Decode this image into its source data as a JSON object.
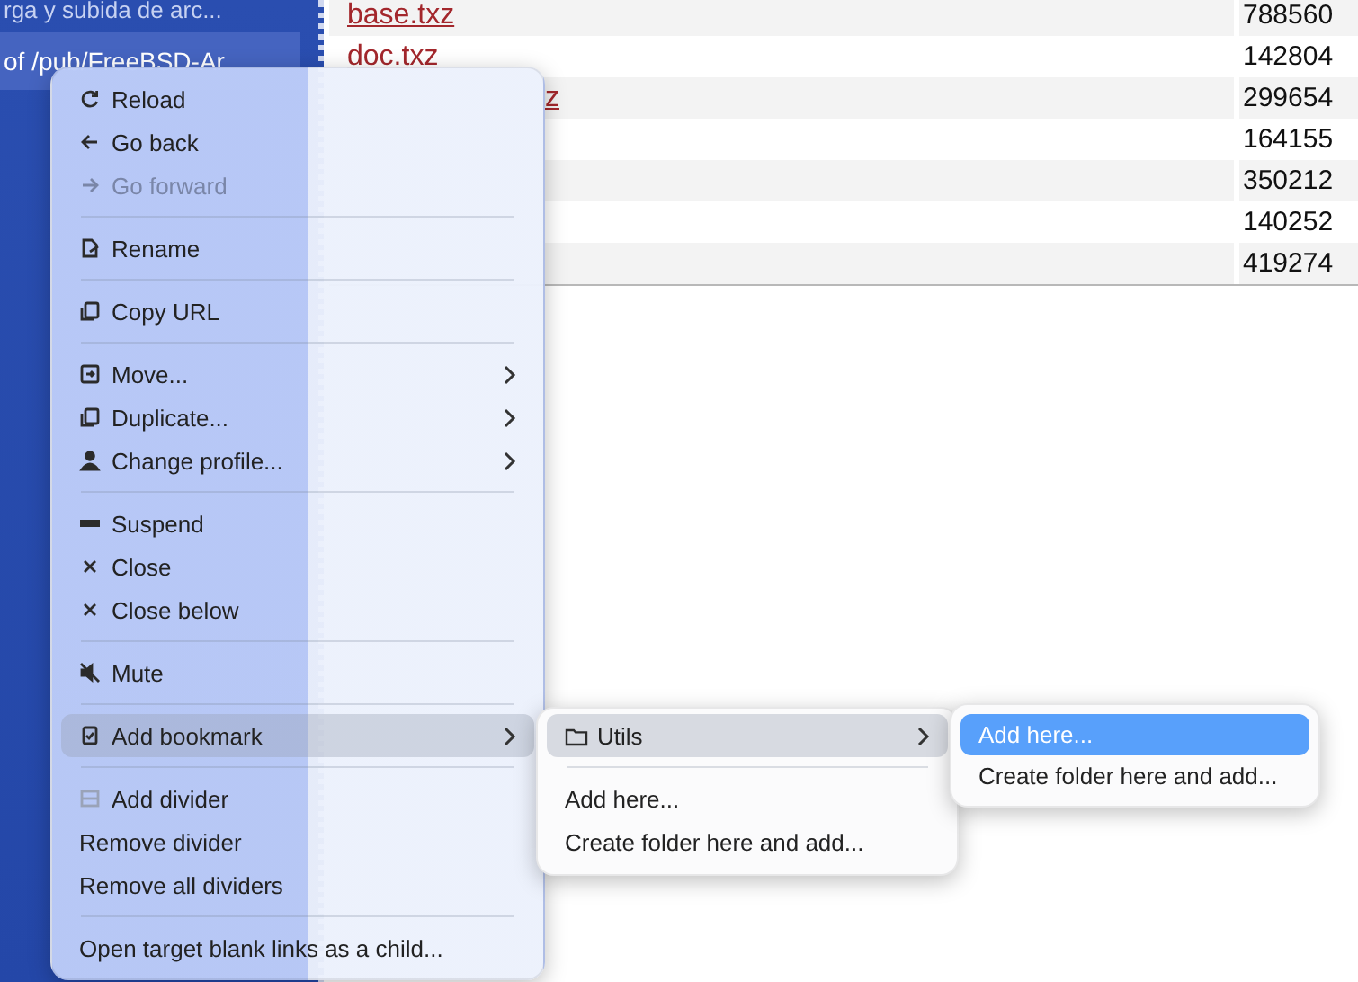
{
  "sidebar": {
    "items": [
      {
        "label": "rga y subida de arc...",
        "selected": false
      },
      {
        "label": "of /pub/FreeBSD-Ar",
        "selected": true
      }
    ]
  },
  "table": {
    "rows": [
      {
        "name": "base.txz",
        "size": "788560"
      },
      {
        "name": "doc.txz",
        "size": "142804"
      },
      {
        "name": "z",
        "size": "299654",
        "partial": true
      },
      {
        "name": "",
        "size": "164155"
      },
      {
        "name": "",
        "size": "350212"
      },
      {
        "name": "",
        "size": "140252"
      },
      {
        "name": "",
        "size": "419274"
      }
    ]
  },
  "context_menu": {
    "groups": [
      [
        {
          "label": "Reload",
          "has_icon": true,
          "disabled": false,
          "submenu": false,
          "selected": false
        },
        {
          "label": "Go back",
          "has_icon": true,
          "disabled": false,
          "submenu": false,
          "selected": false
        },
        {
          "label": "Go forward",
          "has_icon": true,
          "disabled": true,
          "submenu": false,
          "selected": false
        }
      ],
      [
        {
          "label": "Rename",
          "has_icon": true,
          "disabled": false,
          "submenu": false,
          "selected": false
        }
      ],
      [
        {
          "label": "Copy URL",
          "has_icon": true,
          "disabled": false,
          "submenu": false,
          "selected": false
        }
      ],
      [
        {
          "label": "Move...",
          "has_icon": true,
          "disabled": false,
          "submenu": true,
          "selected": false
        },
        {
          "label": "Duplicate...",
          "has_icon": true,
          "disabled": false,
          "submenu": true,
          "selected": false
        },
        {
          "label": "Change profile...",
          "has_icon": true,
          "disabled": false,
          "submenu": true,
          "selected": false
        }
      ],
      [
        {
          "label": "Suspend",
          "has_icon": true,
          "disabled": false,
          "submenu": false,
          "selected": false
        },
        {
          "label": "Close",
          "has_icon": true,
          "disabled": false,
          "submenu": false,
          "selected": false
        },
        {
          "label": "Close below",
          "has_icon": true,
          "disabled": false,
          "submenu": false,
          "selected": false
        }
      ],
      [
        {
          "label": "Mute",
          "has_icon": true,
          "disabled": false,
          "submenu": false,
          "selected": false
        }
      ],
      [
        {
          "label": "Add bookmark",
          "has_icon": true,
          "disabled": false,
          "submenu": true,
          "selected": true
        }
      ],
      [
        {
          "label": "Add divider",
          "has_icon": true,
          "disabled": false,
          "submenu": false,
          "selected": false
        },
        {
          "label": "Remove divider",
          "has_icon": false,
          "disabled": false,
          "submenu": false,
          "selected": false
        },
        {
          "label": "Remove all dividers",
          "has_icon": false,
          "disabled": false,
          "submenu": false,
          "selected": false
        }
      ],
      [
        {
          "label": "Open target blank links as a child...",
          "has_icon": false,
          "disabled": false,
          "submenu": false,
          "selected": false
        }
      ]
    ]
  },
  "bookmark_menu": {
    "groups": [
      [
        {
          "label": "Utils",
          "has_icon": true,
          "submenu": true,
          "selected": true
        }
      ],
      [
        {
          "label": "Add here...",
          "has_icon": false,
          "submenu": false,
          "selected": false
        },
        {
          "label": "Create folder here and add...",
          "has_icon": false,
          "submenu": false,
          "selected": false
        }
      ]
    ]
  },
  "folder_menu": {
    "items": [
      {
        "label": "Add here...",
        "selected": true
      },
      {
        "label": "Create folder here and add...",
        "selected": false
      }
    ]
  }
}
